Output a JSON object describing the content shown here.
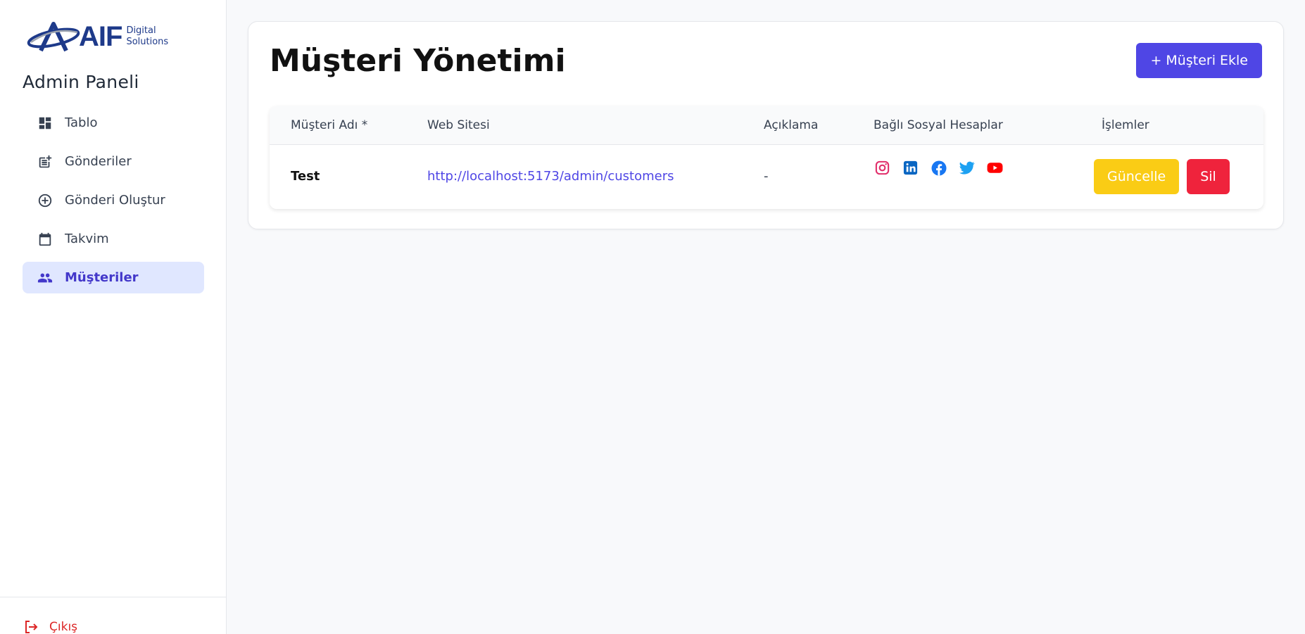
{
  "logo": {
    "brand": "AIF",
    "sub_line1": "Digital",
    "sub_line2": "Solutions"
  },
  "sidebar": {
    "title": "Admin Paneli",
    "items": [
      {
        "label": "Tablo",
        "icon": "dashboard-icon",
        "active": false
      },
      {
        "label": "Gönderiler",
        "icon": "post-add-icon",
        "active": false
      },
      {
        "label": "Gönderi Oluştur",
        "icon": "plus-circle-icon",
        "active": false
      },
      {
        "label": "Takvim",
        "icon": "calendar-icon",
        "active": false
      },
      {
        "label": "Müşteriler",
        "icon": "people-icon",
        "active": true
      }
    ],
    "logout_label": "Çıkış"
  },
  "main": {
    "title": "Müşteri Yönetimi",
    "add_button": "+ Müşteri Ekle",
    "table": {
      "headers": [
        "Müşteri Adı *",
        "Web Sitesi",
        "Açıklama",
        "Bağlı Sosyal Hesaplar",
        "İşlemler"
      ],
      "rows": [
        {
          "name": "Test",
          "website": "http://localhost:5173/admin/customers",
          "description": "-",
          "socials": [
            "instagram-icon",
            "linkedin-icon",
            "facebook-icon",
            "twitter-icon",
            "youtube-icon"
          ],
          "update_label": "Güncelle",
          "delete_label": "Sil"
        }
      ]
    }
  },
  "colors": {
    "primary": "#4f46e5",
    "active_bg": "#e0e7ff",
    "update": "#facc15",
    "delete": "#ef233c",
    "logout": "#dc2626",
    "instagram": "#e1306c",
    "linkedin": "#0a66c2",
    "facebook": "#1877f2",
    "twitter": "#1da1f2",
    "youtube": "#ff0000"
  }
}
